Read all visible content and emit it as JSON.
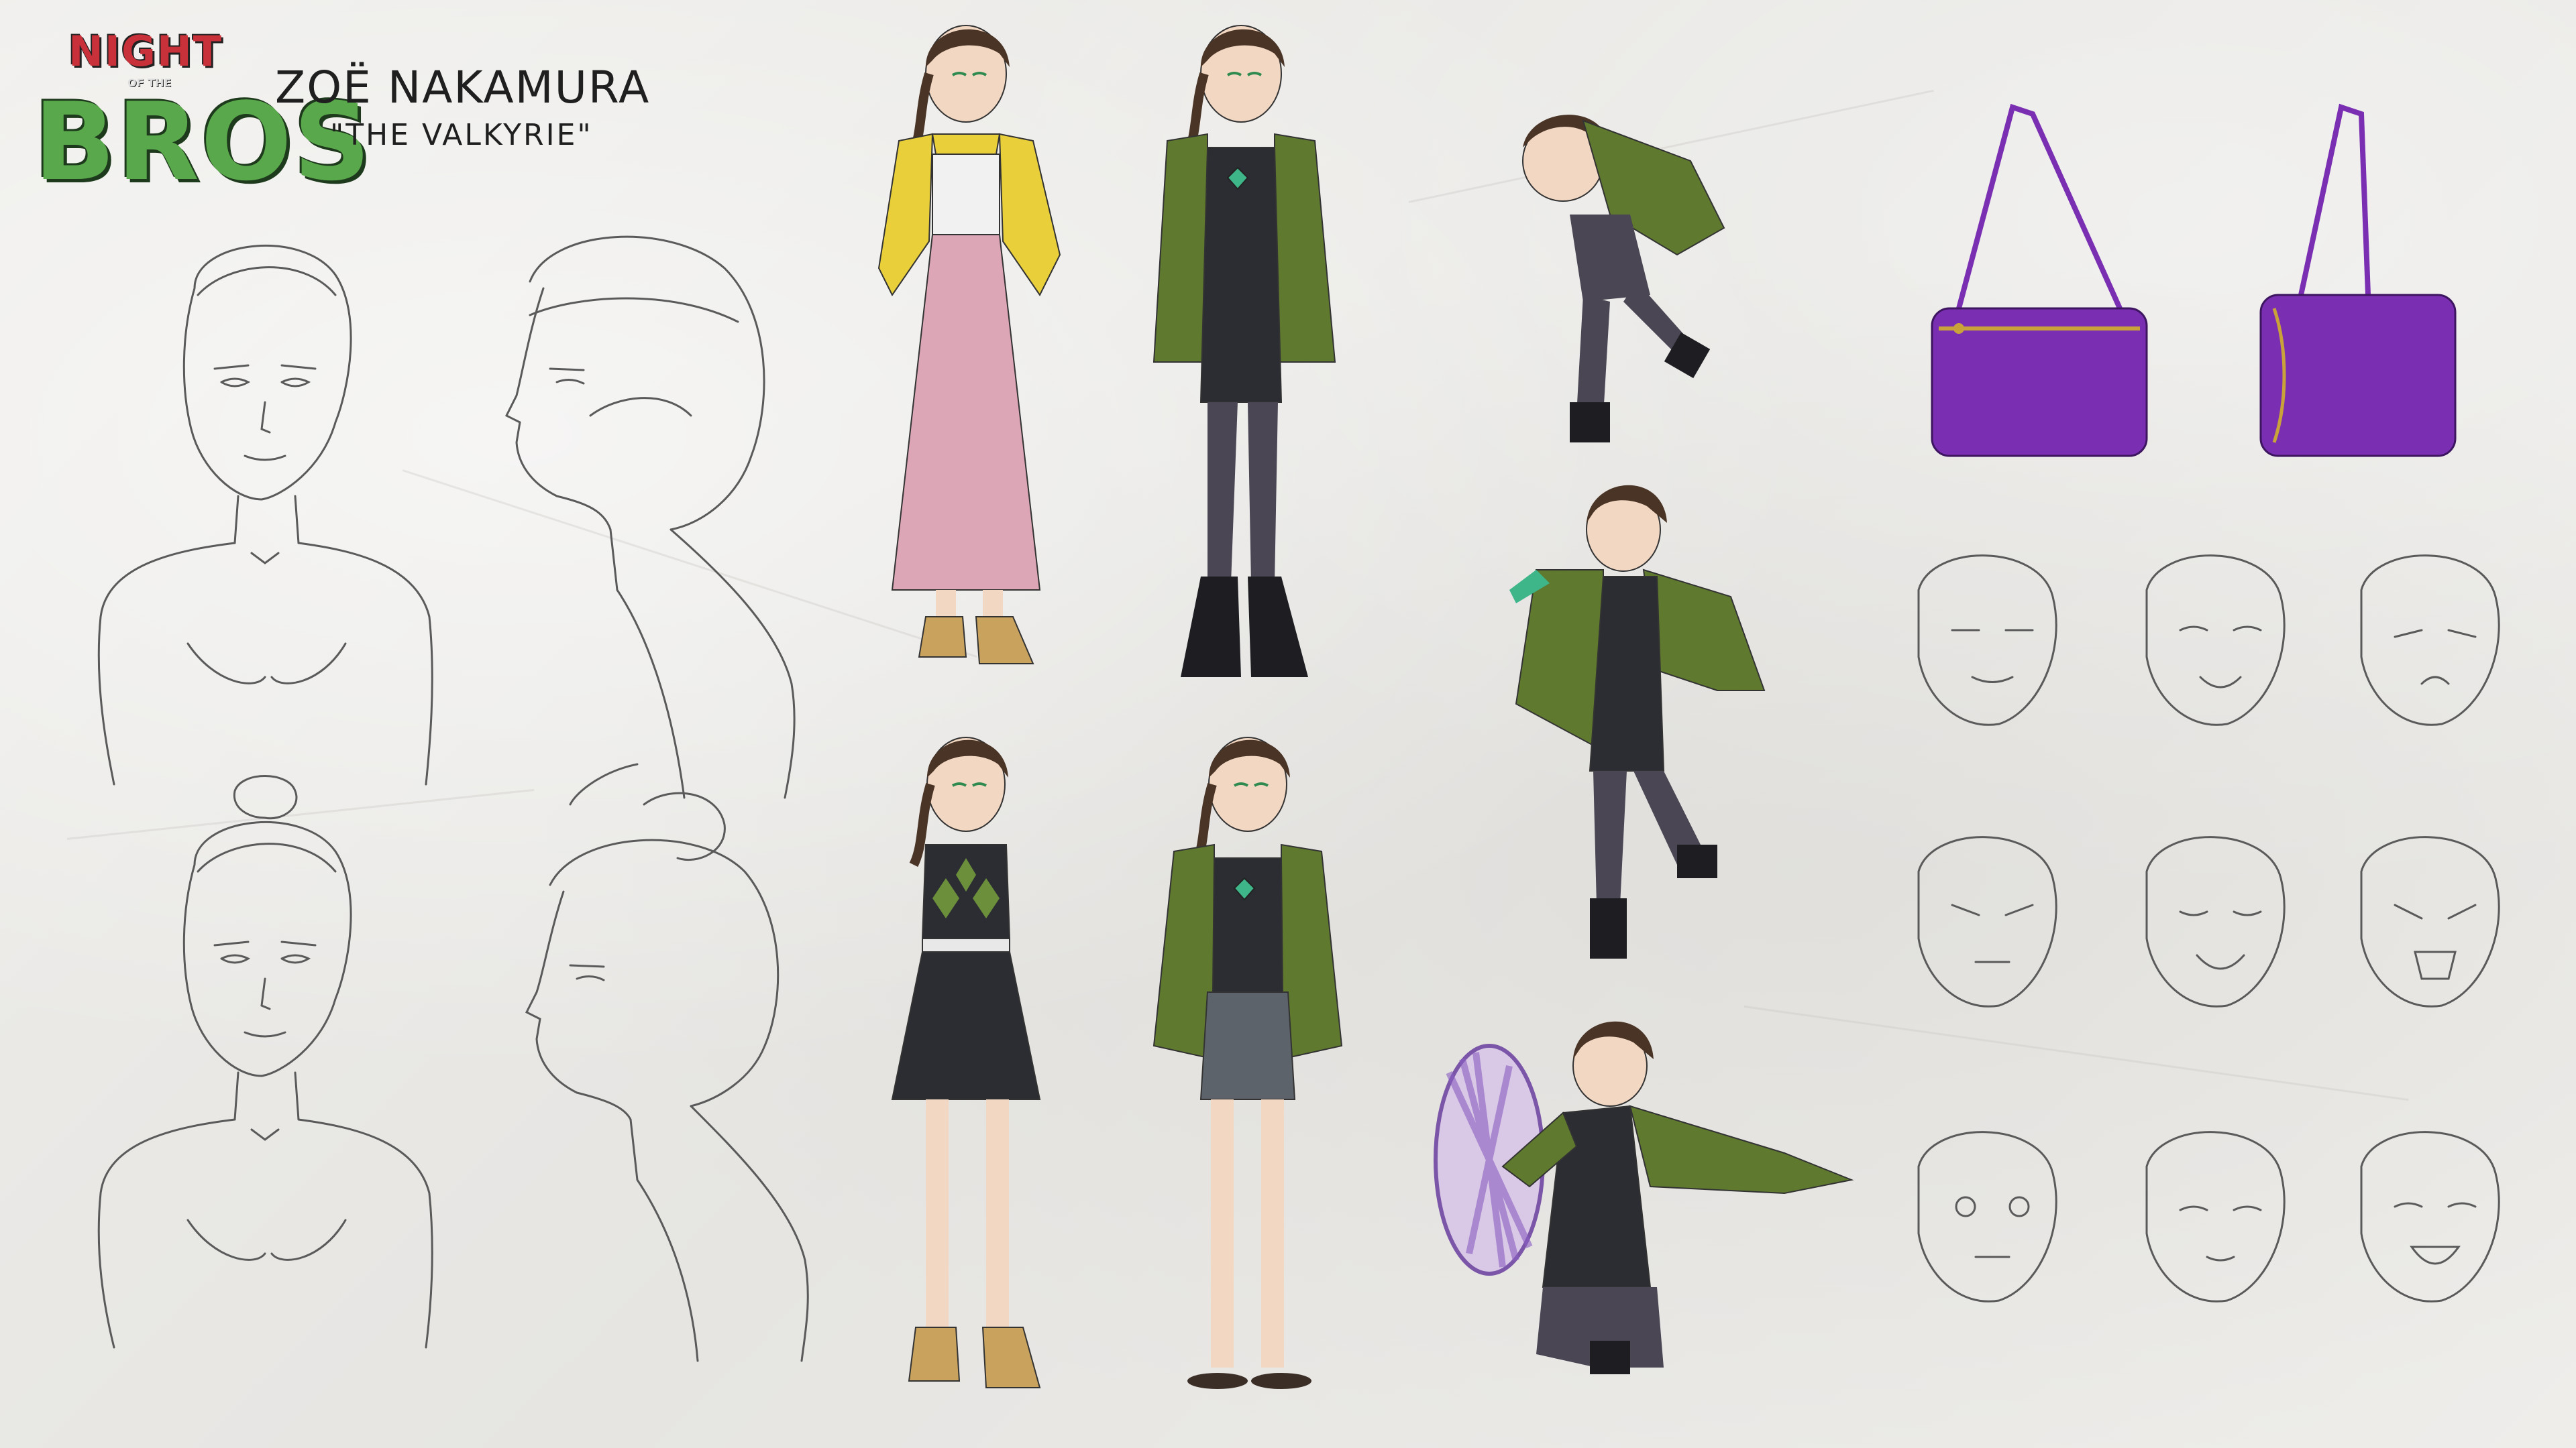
{
  "logo": {
    "night": "NIGHT",
    "of_the": "OF THE",
    "bros": "BROS"
  },
  "character": {
    "name": "ZOË NAKAMURA",
    "title": "\"THE VALKYRIE\""
  },
  "colors": {
    "paper": "#ecebe8",
    "pencil": "#5a5a5a",
    "jacket_yellow": "#e9cf3a",
    "jacket_green": "#5f7a2e",
    "skirt_pink": "#dca6b6",
    "dress_black": "#2b2d33",
    "tights": "#4a4654",
    "boots_tan": "#c9a25e",
    "bag_purple": "#7a2fb3",
    "pendant_green": "#3fb58a",
    "logo_red": "#c8303a",
    "logo_green": "#5aa84c"
  },
  "icons": {
    "bag": "shoulder-bag-icon"
  }
}
